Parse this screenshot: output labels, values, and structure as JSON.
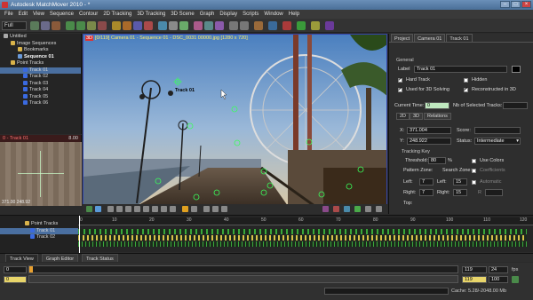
{
  "window": {
    "title": "Autodesk MatchMover 2010 - *"
  },
  "menu": [
    "File",
    "Edit",
    "View",
    "Sequence",
    "Contour",
    "2D Tracking",
    "3D Tracking",
    "3D Scene",
    "Graph",
    "Display",
    "Scripts",
    "Window",
    "Help"
  ],
  "toolbar": {
    "mode_select": "Full"
  },
  "project_tree": {
    "root": "Untitled",
    "image_sequences_label": "Image Sequences",
    "bookmarks_label": "Bookmarks",
    "sequence_label": "Sequence 01",
    "point_tracks_label": "Point Tracks",
    "tracks": [
      "Track 01",
      "Track 02",
      "Track 03",
      "Track 04",
      "Track 05",
      "Track 06"
    ]
  },
  "track_preview": {
    "title": "0 - Track 01",
    "zoom": "8.00",
    "coords": "371.00 248.92"
  },
  "viewport": {
    "badge": "3D",
    "info": "[0/119] Camera 01 - Sequence 01 - DSC_0031 00000.jpg [1280 x 720]",
    "track_label": "Track 01"
  },
  "right_panel": {
    "tabs": [
      "Project",
      "Camera 01",
      "Track 01"
    ],
    "general_label": "General",
    "label_caption": "Label",
    "label_value": "Track 01",
    "hard_track": "Hard Track",
    "hidden": "Hidden",
    "used_3d": "Used for 3D Solving",
    "reconstructed": "Reconstructed in 3D",
    "current_time_label": "Current Time:",
    "current_time": "0",
    "nb_selected_label": "Nb of Selected Tracks:",
    "subtabs": [
      "2D",
      "3D",
      "Relations"
    ],
    "x_label": "X:",
    "x_value": "371.004",
    "y_label": "Y:",
    "y_value": "248.922",
    "score_label": "Score:",
    "status_label": "Status:",
    "status_value": "Intermediate",
    "tracking_key_label": "Tracking Key",
    "threshold_label": "Threshold:",
    "threshold_value": "80",
    "threshold_unit": "%",
    "use_colors": "Use Colors",
    "pattern_zone": "Pattern Zone:",
    "search_zone": "Search Zone:",
    "coefficients": "Coefficients",
    "automatic": "Automatic",
    "left_label": "Left:",
    "left_pattern": "7",
    "left_search": "15",
    "right_label": "Right:",
    "right_pattern": "7",
    "right_search": "15",
    "r_label": "R",
    "top_label": "Top:"
  },
  "timeline": {
    "tree_header": "Point Tracks",
    "tracks": [
      "Track 01",
      "Track 02"
    ],
    "ticks": [
      "0",
      "10",
      "20",
      "30",
      "40",
      "50",
      "60",
      "70",
      "80",
      "90",
      "100",
      "110",
      "120"
    ]
  },
  "bottom_tabs": [
    "Track View",
    "Graph Editor",
    "Track Status"
  ],
  "transport": {
    "start": "0",
    "start2": "0",
    "end": "119",
    "end2": "119",
    "fps": "24",
    "fps_label": "fps",
    "speed": "100",
    "cache": "Cache: 5.28/-2048.00 Mb"
  }
}
